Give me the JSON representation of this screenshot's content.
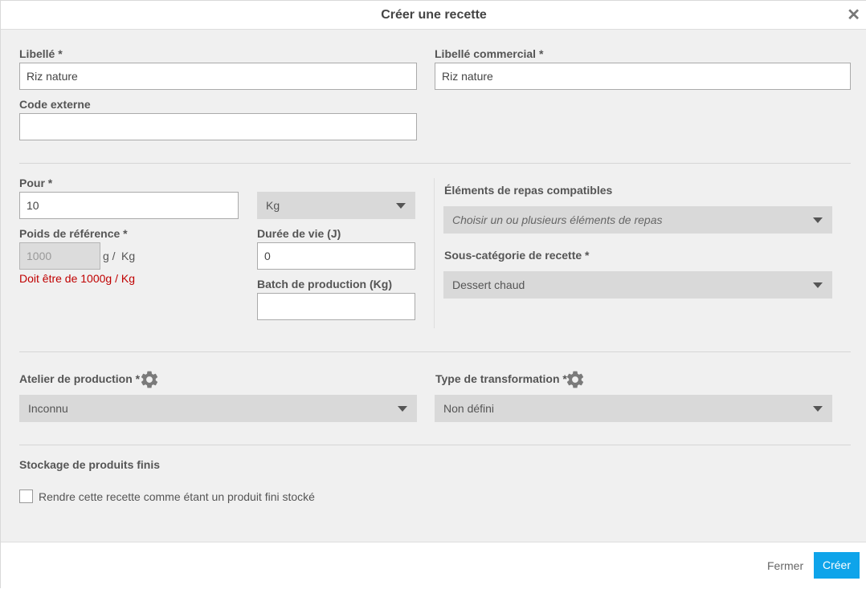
{
  "dialog": {
    "title": "Créer une recette"
  },
  "fields": {
    "libelle": {
      "label": "Libellé *",
      "value": "Riz nature"
    },
    "libelle_commercial": {
      "label": "Libellé commercial *",
      "value": "Riz nature"
    },
    "code_externe": {
      "label": "Code externe",
      "value": ""
    },
    "pour": {
      "label": "Pour *",
      "value": "10",
      "unit": "Kg"
    },
    "poids_reference": {
      "label": "Poids de référence *",
      "value": "1000",
      "unit_g": "g /",
      "unit_kg": "Kg",
      "error": "Doit être de 1000g / Kg"
    },
    "duree_vie": {
      "label": "Durée de vie (J)",
      "value": "0"
    },
    "batch_production": {
      "label": "Batch de production (Kg)",
      "value": ""
    },
    "elements_repas": {
      "label": "Éléments de repas compatibles",
      "placeholder": "Choisir un ou plusieurs éléments de repas"
    },
    "sous_categorie": {
      "label": "Sous-catégorie de recette *",
      "value": "Dessert chaud"
    },
    "atelier": {
      "label": "Atelier de production *",
      "value": "Inconnu"
    },
    "transformation": {
      "label": "Type de transformation *",
      "value": "Non défini"
    }
  },
  "stockage": {
    "title": "Stockage de produits finis",
    "checkbox_label": "Rendre cette recette comme étant un produit fini stocké",
    "checked": false
  },
  "footer": {
    "close_label": "Fermer",
    "create_label": "Créer"
  },
  "colors": {
    "primary": "#0ea4ea",
    "error": "#c00000",
    "select_bg": "#d9d9d9",
    "body_bg": "#f0f0f0"
  },
  "icons": {
    "close": "close-icon",
    "settings": "gear-icon",
    "dropdown": "chevron-down-icon"
  }
}
